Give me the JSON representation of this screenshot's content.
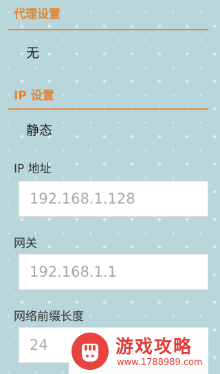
{
  "proxy_section": {
    "title": "代理设置",
    "value": "无"
  },
  "ip_section": {
    "title": "IP 设置",
    "value": "静态"
  },
  "fields": {
    "ip_address": {
      "label": "IP 地址",
      "placeholder": "192.168.1.128"
    },
    "gateway": {
      "label": "网关",
      "placeholder": "192.168.1.1"
    },
    "prefix_length": {
      "label": "网络前缀长度",
      "placeholder": "24"
    }
  },
  "watermark": {
    "title": "游戏攻略",
    "url": "www.1788989.com"
  },
  "colors": {
    "accent": "#e8822e",
    "background": "#b9d6da",
    "watermark": "#e23b36"
  }
}
